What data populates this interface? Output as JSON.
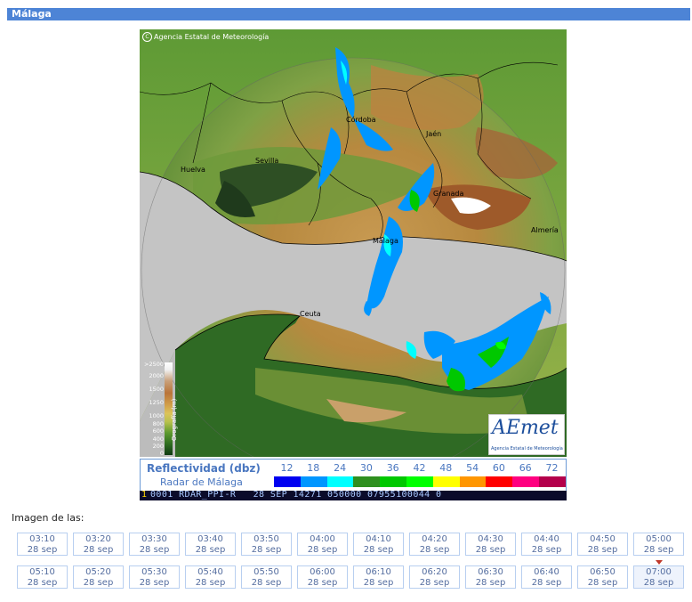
{
  "title": "Málaga",
  "radar": {
    "copyright": "Agencia Estatal de Meteorología",
    "cities": [
      {
        "name": "Córdoba"
      },
      {
        "name": "Jaén"
      },
      {
        "name": "Sevilla"
      },
      {
        "name": "Huelva"
      },
      {
        "name": "Granada"
      },
      {
        "name": "Málaga"
      },
      {
        "name": "Almería"
      },
      {
        "name": "Ceuta"
      }
    ],
    "orography": {
      "title": "Orografía (m)",
      "levels": [
        ">2500",
        "2000",
        "1500",
        "1250",
        "1000",
        "800",
        "600",
        "400",
        "200",
        "0"
      ]
    },
    "logo": {
      "text": "AEmet",
      "subtitle": "Agencia Estatal de Meteorología"
    }
  },
  "reflectivity": {
    "title": "Reflectividad (dbz)",
    "subtitle": "Radar de Málaga",
    "values": [
      "12",
      "18",
      "24",
      "30",
      "36",
      "42",
      "48",
      "54",
      "60",
      "66",
      "72"
    ],
    "colors": [
      "#0000f0",
      "#0096ff",
      "#00ffff",
      "#2f8f1f",
      "#00c800",
      "#00ff00",
      "#ffff00",
      "#ff9600",
      "#ff0000",
      "#ff0080",
      "#b4004b"
    ]
  },
  "strip_text": "0001 RDAR_PPI-R   28 SEP 14271 050000 07955100044 0",
  "strip_prefix": "1",
  "image_label": "Imagen de las:",
  "times": [
    {
      "time": "03:10",
      "date": "28 sep"
    },
    {
      "time": "03:20",
      "date": "28 sep"
    },
    {
      "time": "03:30",
      "date": "28 sep"
    },
    {
      "time": "03:40",
      "date": "28 sep"
    },
    {
      "time": "03:50",
      "date": "28 sep"
    },
    {
      "time": "04:00",
      "date": "28 sep"
    },
    {
      "time": "04:10",
      "date": "28 sep"
    },
    {
      "time": "04:20",
      "date": "28 sep"
    },
    {
      "time": "04:30",
      "date": "28 sep"
    },
    {
      "time": "04:40",
      "date": "28 sep"
    },
    {
      "time": "04:50",
      "date": "28 sep"
    },
    {
      "time": "05:00",
      "date": "28 sep"
    },
    {
      "time": "05:10",
      "date": "28 sep"
    },
    {
      "time": "05:20",
      "date": "28 sep"
    },
    {
      "time": "05:30",
      "date": "28 sep"
    },
    {
      "time": "05:40",
      "date": "28 sep"
    },
    {
      "time": "05:50",
      "date": "28 sep"
    },
    {
      "time": "06:00",
      "date": "28 sep"
    },
    {
      "time": "06:10",
      "date": "28 sep"
    },
    {
      "time": "06:20",
      "date": "28 sep"
    },
    {
      "time": "06:30",
      "date": "28 sep"
    },
    {
      "time": "06:40",
      "date": "28 sep"
    },
    {
      "time": "06:50",
      "date": "28 sep"
    },
    {
      "time": "07:00",
      "date": "28 sep"
    }
  ],
  "selected_index": 23,
  "marker_index": 11,
  "cutoff_text": "...."
}
